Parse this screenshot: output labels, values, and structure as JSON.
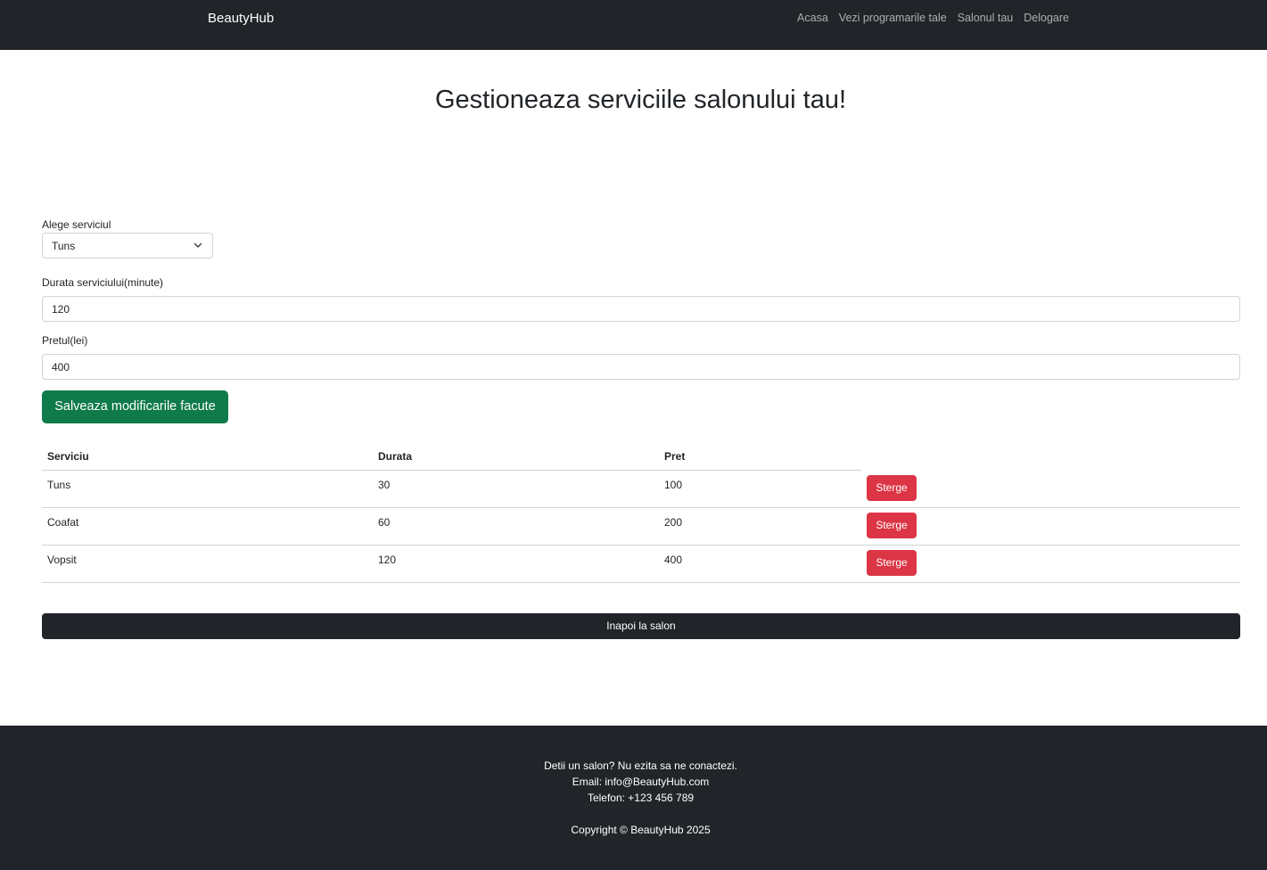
{
  "navbar": {
    "brand": "BeautyHub",
    "links": [
      "Acasa",
      "Vezi programarile tale",
      "Salonul tau",
      "Delogare"
    ]
  },
  "page_title": "Gestioneaza serviciile salonului tau!",
  "form": {
    "service_label": "Alege serviciul",
    "service_selected": "Tuns",
    "duration_label": "Durata serviciului(minute)",
    "duration_value": "120",
    "price_label": "Pretul(lei)",
    "price_value": "400",
    "save_label": "Salveaza modificarile facute"
  },
  "table": {
    "headers": [
      "Serviciu",
      "Durata",
      "Pret"
    ],
    "rows": [
      {
        "service": "Tuns",
        "duration": "30",
        "price": "100",
        "action": "Sterge"
      },
      {
        "service": "Coafat",
        "duration": "60",
        "price": "200",
        "action": "Sterge"
      },
      {
        "service": "Vopsit",
        "duration": "120",
        "price": "400",
        "action": "Sterge"
      }
    ]
  },
  "back_label": "Inapoi la salon",
  "footer": {
    "line1": "Detii un salon? Nu ezita sa ne conactezi.",
    "line2": "Email: info@BeautyHub.com",
    "line3": "Telefon: +123 456 789",
    "copyright": "Copyright © BeautyHub 2025"
  },
  "colors": {
    "navbar_bg": "#212529",
    "save_button": "#0f7a4a",
    "delete_button": "#dc3545"
  }
}
